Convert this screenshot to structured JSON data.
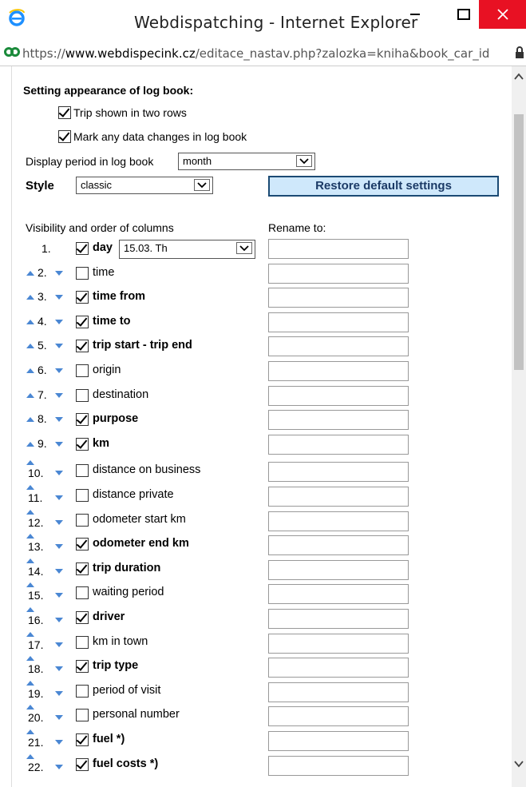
{
  "window": {
    "title": "Webdispatching - Internet Explorer",
    "url_scheme": "https://",
    "url_domain": "www.webdispecink.cz",
    "url_path": "/editace_nastav.php?zalozka=kniha&book_car_id"
  },
  "settings": {
    "heading": "Setting appearance of log book:",
    "trip_two_rows": {
      "label": "Trip shown in two rows",
      "checked": true
    },
    "mark_changes": {
      "label": "Mark any data changes in log book",
      "checked": true
    },
    "display_period_label": "Display period in log book",
    "display_period_value": "month",
    "style_label": "Style",
    "style_value": "classic",
    "restore_button": "Restore default settings",
    "visibility_label": "Visibility and order of columns",
    "rename_label": "Rename to:"
  },
  "columns": [
    {
      "num": "1.",
      "label": "day",
      "checked": true,
      "day_select": "15.03. Th"
    },
    {
      "num": "2.",
      "label": "time",
      "checked": false
    },
    {
      "num": "3.",
      "label": "time from",
      "checked": true
    },
    {
      "num": "4.",
      "label": "time to",
      "checked": true
    },
    {
      "num": "5.",
      "label": "trip start - trip end",
      "checked": true
    },
    {
      "num": "6.",
      "label": "origin",
      "checked": false
    },
    {
      "num": "7.",
      "label": "destination",
      "checked": false
    },
    {
      "num": "8.",
      "label": "purpose",
      "checked": true
    },
    {
      "num": "9.",
      "label": "km",
      "checked": true
    },
    {
      "num": "10.",
      "label": "distance on business",
      "checked": false
    },
    {
      "num": "11.",
      "label": "distance private",
      "checked": false
    },
    {
      "num": "12.",
      "label": "odometer start km",
      "checked": false
    },
    {
      "num": "13.",
      "label": "odometer end km",
      "checked": true
    },
    {
      "num": "14.",
      "label": "trip duration",
      "checked": true
    },
    {
      "num": "15.",
      "label": "waiting period",
      "checked": false
    },
    {
      "num": "16.",
      "label": "driver",
      "checked": true
    },
    {
      "num": "17.",
      "label": "km in town",
      "checked": false
    },
    {
      "num": "18.",
      "label": "trip type",
      "checked": true
    },
    {
      "num": "19.",
      "label": "period of visit",
      "checked": false
    },
    {
      "num": "20.",
      "label": "personal number",
      "checked": false
    },
    {
      "num": "21.",
      "label": "fuel *)",
      "checked": true
    },
    {
      "num": "22.",
      "label": "fuel costs *)",
      "checked": true
    }
  ],
  "colors": {
    "accent": "#4a87d3",
    "close": "#e81123",
    "button_bg": "#cfe8fb"
  }
}
